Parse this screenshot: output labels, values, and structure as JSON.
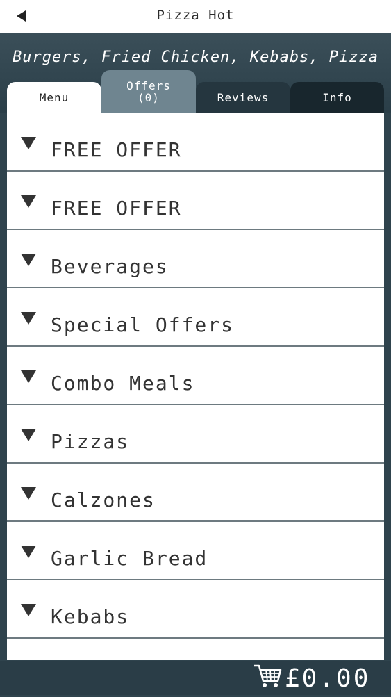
{
  "header": {
    "title": "Pizza Hot",
    "back_icon": "back-arrow-icon"
  },
  "restaurant": {
    "cuisines": "Burgers, Fried Chicken, Kebabs, Pizza"
  },
  "tabs": [
    {
      "label": "Menu",
      "active": true
    },
    {
      "label": "Offers\n(0)",
      "active": false
    },
    {
      "label": "Reviews",
      "active": false
    },
    {
      "label": "Info",
      "active": false
    }
  ],
  "menu": {
    "expand_icon": "caret-down-icon",
    "categories": [
      {
        "label": "FREE OFFER"
      },
      {
        "label": "FREE OFFER"
      },
      {
        "label": "Beverages"
      },
      {
        "label": "Special Offers"
      },
      {
        "label": "Combo Meals"
      },
      {
        "label": "Pizzas"
      },
      {
        "label": "Calzones"
      },
      {
        "label": "Garlic Bread"
      },
      {
        "label": "Kebabs"
      }
    ]
  },
  "cart": {
    "icon": "cart-icon",
    "total": "£0.00"
  },
  "colors": {
    "background": "#2f434d",
    "active_tab": "#ffffff",
    "offers_tab": "#6f8590",
    "reviews_tab": "#25363f",
    "info_tab": "#18262d"
  }
}
